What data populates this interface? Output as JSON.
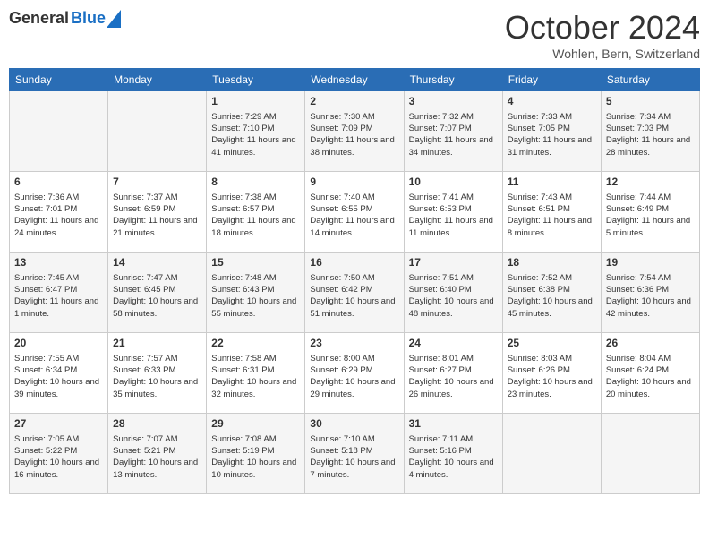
{
  "header": {
    "logo_general": "General",
    "logo_blue": "Blue",
    "title": "October 2024",
    "location": "Wohlen, Bern, Switzerland"
  },
  "columns": [
    "Sunday",
    "Monday",
    "Tuesday",
    "Wednesday",
    "Thursday",
    "Friday",
    "Saturday"
  ],
  "weeks": [
    [
      {
        "day": "",
        "info": ""
      },
      {
        "day": "",
        "info": ""
      },
      {
        "day": "1",
        "info": "Sunrise: 7:29 AM\nSunset: 7:10 PM\nDaylight: 11 hours and 41 minutes."
      },
      {
        "day": "2",
        "info": "Sunrise: 7:30 AM\nSunset: 7:09 PM\nDaylight: 11 hours and 38 minutes."
      },
      {
        "day": "3",
        "info": "Sunrise: 7:32 AM\nSunset: 7:07 PM\nDaylight: 11 hours and 34 minutes."
      },
      {
        "day": "4",
        "info": "Sunrise: 7:33 AM\nSunset: 7:05 PM\nDaylight: 11 hours and 31 minutes."
      },
      {
        "day": "5",
        "info": "Sunrise: 7:34 AM\nSunset: 7:03 PM\nDaylight: 11 hours and 28 minutes."
      }
    ],
    [
      {
        "day": "6",
        "info": "Sunrise: 7:36 AM\nSunset: 7:01 PM\nDaylight: 11 hours and 24 minutes."
      },
      {
        "day": "7",
        "info": "Sunrise: 7:37 AM\nSunset: 6:59 PM\nDaylight: 11 hours and 21 minutes."
      },
      {
        "day": "8",
        "info": "Sunrise: 7:38 AM\nSunset: 6:57 PM\nDaylight: 11 hours and 18 minutes."
      },
      {
        "day": "9",
        "info": "Sunrise: 7:40 AM\nSunset: 6:55 PM\nDaylight: 11 hours and 14 minutes."
      },
      {
        "day": "10",
        "info": "Sunrise: 7:41 AM\nSunset: 6:53 PM\nDaylight: 11 hours and 11 minutes."
      },
      {
        "day": "11",
        "info": "Sunrise: 7:43 AM\nSunset: 6:51 PM\nDaylight: 11 hours and 8 minutes."
      },
      {
        "day": "12",
        "info": "Sunrise: 7:44 AM\nSunset: 6:49 PM\nDaylight: 11 hours and 5 minutes."
      }
    ],
    [
      {
        "day": "13",
        "info": "Sunrise: 7:45 AM\nSunset: 6:47 PM\nDaylight: 11 hours and 1 minute."
      },
      {
        "day": "14",
        "info": "Sunrise: 7:47 AM\nSunset: 6:45 PM\nDaylight: 10 hours and 58 minutes."
      },
      {
        "day": "15",
        "info": "Sunrise: 7:48 AM\nSunset: 6:43 PM\nDaylight: 10 hours and 55 minutes."
      },
      {
        "day": "16",
        "info": "Sunrise: 7:50 AM\nSunset: 6:42 PM\nDaylight: 10 hours and 51 minutes."
      },
      {
        "day": "17",
        "info": "Sunrise: 7:51 AM\nSunset: 6:40 PM\nDaylight: 10 hours and 48 minutes."
      },
      {
        "day": "18",
        "info": "Sunrise: 7:52 AM\nSunset: 6:38 PM\nDaylight: 10 hours and 45 minutes."
      },
      {
        "day": "19",
        "info": "Sunrise: 7:54 AM\nSunset: 6:36 PM\nDaylight: 10 hours and 42 minutes."
      }
    ],
    [
      {
        "day": "20",
        "info": "Sunrise: 7:55 AM\nSunset: 6:34 PM\nDaylight: 10 hours and 39 minutes."
      },
      {
        "day": "21",
        "info": "Sunrise: 7:57 AM\nSunset: 6:33 PM\nDaylight: 10 hours and 35 minutes."
      },
      {
        "day": "22",
        "info": "Sunrise: 7:58 AM\nSunset: 6:31 PM\nDaylight: 10 hours and 32 minutes."
      },
      {
        "day": "23",
        "info": "Sunrise: 8:00 AM\nSunset: 6:29 PM\nDaylight: 10 hours and 29 minutes."
      },
      {
        "day": "24",
        "info": "Sunrise: 8:01 AM\nSunset: 6:27 PM\nDaylight: 10 hours and 26 minutes."
      },
      {
        "day": "25",
        "info": "Sunrise: 8:03 AM\nSunset: 6:26 PM\nDaylight: 10 hours and 23 minutes."
      },
      {
        "day": "26",
        "info": "Sunrise: 8:04 AM\nSunset: 6:24 PM\nDaylight: 10 hours and 20 minutes."
      }
    ],
    [
      {
        "day": "27",
        "info": "Sunrise: 7:05 AM\nSunset: 5:22 PM\nDaylight: 10 hours and 16 minutes."
      },
      {
        "day": "28",
        "info": "Sunrise: 7:07 AM\nSunset: 5:21 PM\nDaylight: 10 hours and 13 minutes."
      },
      {
        "day": "29",
        "info": "Sunrise: 7:08 AM\nSunset: 5:19 PM\nDaylight: 10 hours and 10 minutes."
      },
      {
        "day": "30",
        "info": "Sunrise: 7:10 AM\nSunset: 5:18 PM\nDaylight: 10 hours and 7 minutes."
      },
      {
        "day": "31",
        "info": "Sunrise: 7:11 AM\nSunset: 5:16 PM\nDaylight: 10 hours and 4 minutes."
      },
      {
        "day": "",
        "info": ""
      },
      {
        "day": "",
        "info": ""
      }
    ]
  ]
}
